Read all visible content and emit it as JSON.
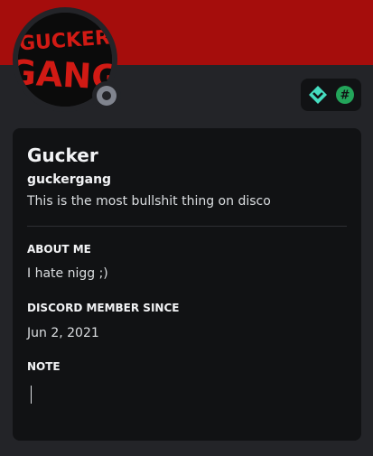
{
  "profile": {
    "display_name": "Gucker",
    "username": "guckergang",
    "custom_status": "This is the most bullshit thing on disco",
    "avatar_text_top": "GUCKER",
    "avatar_text_bottom": "GANG",
    "status": "offline"
  },
  "badges": [
    {
      "icon": "hypesquad-balance-icon"
    },
    {
      "icon": "originally-known-as-hash-icon"
    }
  ],
  "about": {
    "heading": "ABOUT ME",
    "text": "I hate nigg ;)"
  },
  "member_since": {
    "heading": "DISCORD MEMBER SINCE",
    "date": "Jun 2, 2021"
  },
  "note": {
    "heading": "NOTE",
    "value": ""
  },
  "colors": {
    "banner": "#a50d0c",
    "background": "#232428",
    "card": "#111214",
    "badge_green": "#23a55a",
    "text_primary": "#f2f3f5"
  }
}
